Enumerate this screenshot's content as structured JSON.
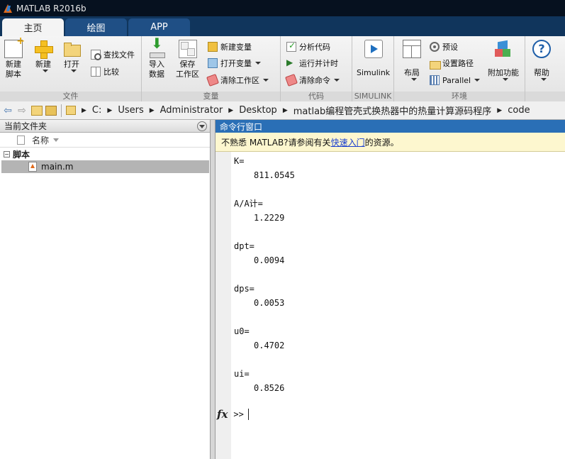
{
  "window": {
    "title": "MATLAB R2016b"
  },
  "tabs": [
    {
      "label": "主页",
      "active": true
    },
    {
      "label": "绘图",
      "active": false
    },
    {
      "label": "APP",
      "active": false
    }
  ],
  "ribbon": {
    "file": {
      "label": "文件",
      "new_script": "新建\n脚本",
      "new_script_l1": "新建",
      "new_script_l2": "脚本",
      "new": "新建",
      "open": "打开",
      "find_files": "查找文件",
      "compare": "比较"
    },
    "variable": {
      "label": "变量",
      "import_l1": "导入",
      "import_l2": "数据",
      "save_l1": "保存",
      "save_l2": "工作区",
      "new_variable": "新建变量",
      "open_variable": "打开变量",
      "clear_workspace": "清除工作区"
    },
    "code": {
      "label": "代码",
      "analyze": "分析代码",
      "run_time": "运行并计时",
      "clear_commands": "清除命令"
    },
    "simulink": {
      "label": "SIMULINK",
      "simulink": "Simulink"
    },
    "environment": {
      "label": "环境",
      "layout": "布局",
      "preferences": "预设",
      "set_path": "设置路径",
      "parallel": "Parallel",
      "addons": "附加功能"
    },
    "resources": {
      "help": "帮助"
    }
  },
  "address": {
    "path": [
      "C:",
      "Users",
      "Administrator",
      "Desktop",
      "matlab编程管壳式换热器中的热量计算源码程序",
      "code"
    ]
  },
  "current_folder": {
    "title": "当前文件夹",
    "column_name": "名称",
    "group": "脚本",
    "files": [
      "main.m"
    ]
  },
  "command_window": {
    "title": "命令行窗口",
    "notice_pre": "不熟悉 MATLAB?请参阅有关",
    "notice_link": "快速入门",
    "notice_post": "的资源。",
    "outputs": [
      {
        "name": "K=",
        "value": "811.0545"
      },
      {
        "name": "A/A计=",
        "value": "1.2229"
      },
      {
        "name": "dpt=",
        "value": "0.0094"
      },
      {
        "name": "dps=",
        "value": "0.0053"
      },
      {
        "name": "u0=",
        "value": "0.4702"
      },
      {
        "name": "ui=",
        "value": "0.8526"
      }
    ],
    "prompt": ">>",
    "fx": "fx"
  }
}
